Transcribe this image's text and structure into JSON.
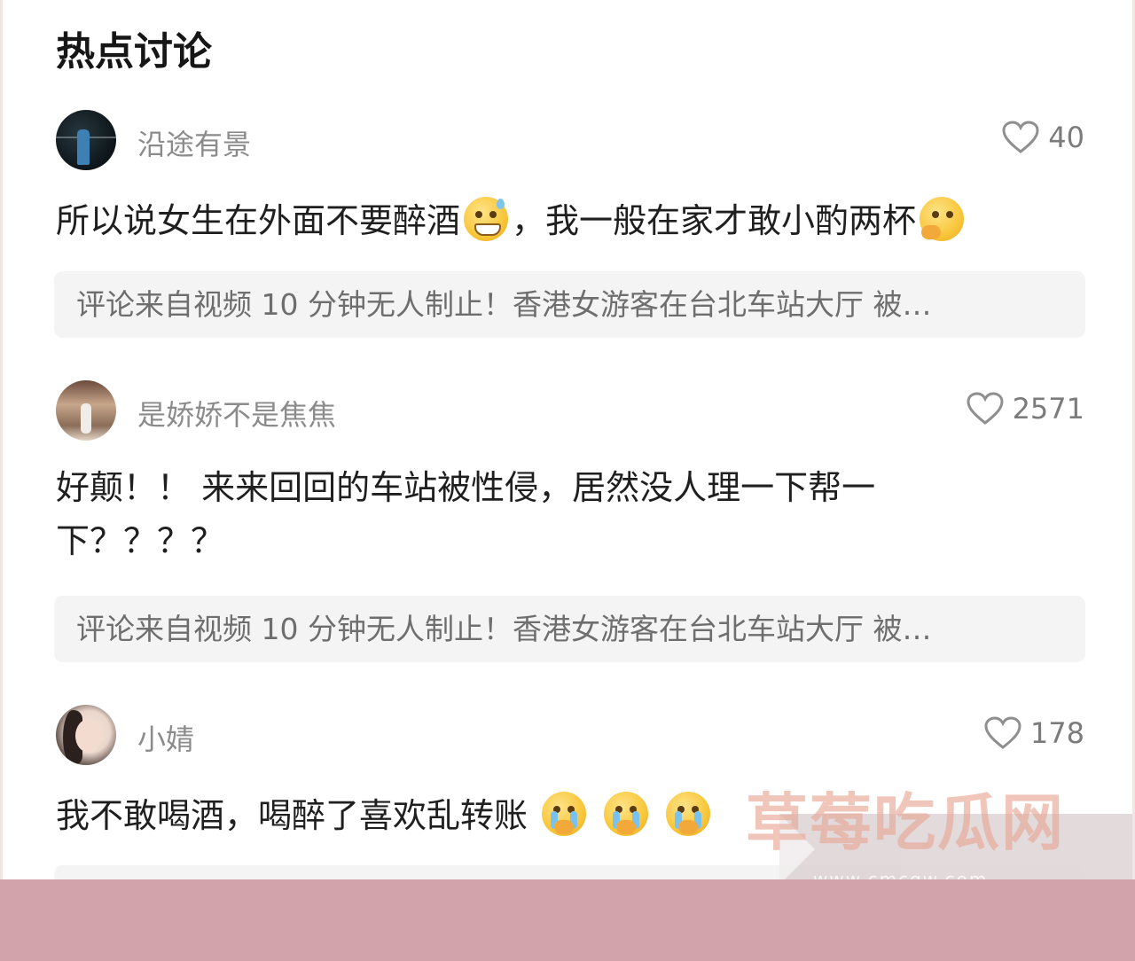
{
  "section_title": "热点讨论",
  "comments": [
    {
      "username": "沿途有景",
      "likes": "40",
      "text_before": "所以说女生在外面不要醉酒",
      "text_middle": "，我一般在家才敢小酌两杯",
      "emoji_1": "grinning-sweat-emoji",
      "emoji_2": "thinking-emoji",
      "source": "评论来自视频 10 分钟无人制止！香港女游客在台北车站大厅 被…"
    },
    {
      "username": "是娇娇不是焦焦",
      "likes": "2571",
      "line1": "好颠！！ 来来回回的车站被性侵，居然没人理一下帮一",
      "line2": "下？？？？",
      "source": "评论来自视频 10 分钟无人制止！香港女游客在台北车站大厅 被…"
    },
    {
      "username": "小婧",
      "likes": "178",
      "text": "我不敢喝酒，喝醉了喜欢乱转账",
      "emojis": [
        "pleading-face-emoji",
        "pleading-face-emoji",
        "pleading-face-emoji"
      ]
    }
  ],
  "watermark": {
    "brand": "草莓吃瓜网",
    "url": "www.cmcgw.com"
  },
  "colors": {
    "bottom_band": "#d2a3ab",
    "source_bg": "#f4f4f4",
    "username": "#8b8b8b"
  }
}
